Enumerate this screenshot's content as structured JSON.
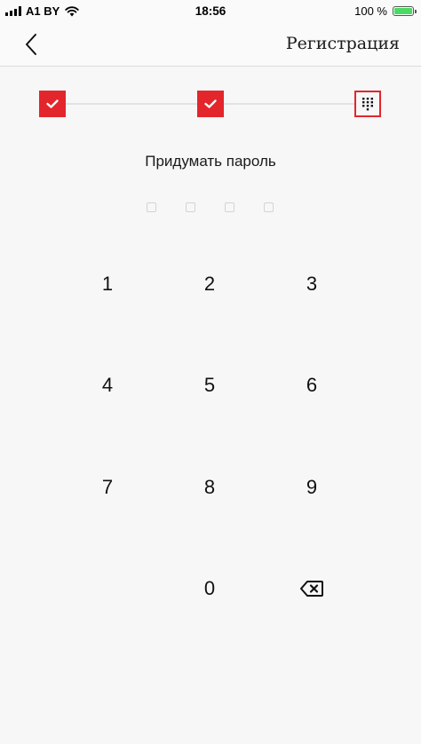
{
  "status_bar": {
    "carrier": "A1 BY",
    "time": "18:56",
    "battery": "100 %",
    "battery_level": 1.0,
    "battery_color": "#4cd964",
    "signal_icon": "signal-bars-icon",
    "wifi_icon": "wifi-icon"
  },
  "nav": {
    "back_icon": "chevron-left-icon",
    "title": "Регистрация"
  },
  "stepper": {
    "accent_color": "#e3262b",
    "steps": [
      {
        "state": "done",
        "icon": "check-icon"
      },
      {
        "state": "done",
        "icon": "check-icon"
      },
      {
        "state": "current",
        "icon": "keypad-icon"
      }
    ]
  },
  "prompt": "Придумать пароль",
  "pin": {
    "length": 4,
    "filled": 0
  },
  "keypad": {
    "keys": [
      "1",
      "2",
      "3",
      "4",
      "5",
      "6",
      "7",
      "8",
      "9",
      "0"
    ],
    "backspace_icon": "backspace-icon"
  }
}
